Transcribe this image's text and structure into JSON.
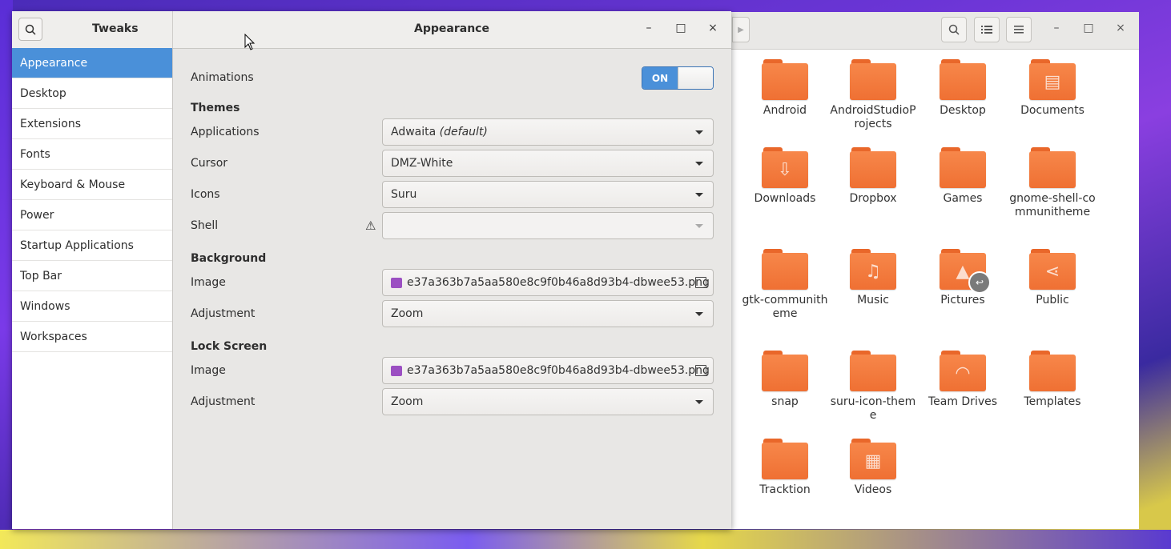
{
  "tweaks": {
    "app_name": "Tweaks",
    "title": "Appearance",
    "sidebar": [
      {
        "label": "Appearance",
        "active": true
      },
      {
        "label": "Desktop"
      },
      {
        "label": "Extensions"
      },
      {
        "label": "Fonts"
      },
      {
        "label": "Keyboard & Mouse"
      },
      {
        "label": "Power"
      },
      {
        "label": "Startup Applications"
      },
      {
        "label": "Top Bar"
      },
      {
        "label": "Windows"
      },
      {
        "label": "Workspaces"
      }
    ],
    "animations": {
      "label": "Animations",
      "state": "ON"
    },
    "themes": {
      "heading": "Themes",
      "applications": {
        "label": "Applications",
        "value": "Adwaita",
        "value_suffix": "(default)"
      },
      "cursor": {
        "label": "Cursor",
        "value": "DMZ-White"
      },
      "icons": {
        "label": "Icons",
        "value": "Suru"
      },
      "shell": {
        "label": "Shell",
        "value": "",
        "warning_icon": "warning-icon"
      }
    },
    "background": {
      "heading": "Background",
      "image": {
        "label": "Image",
        "value": "e37a363b7a5aa580e8c9f0b46a8d93b4-dbwee53.png"
      },
      "adjustment": {
        "label": "Adjustment",
        "value": "Zoom"
      }
    },
    "lock_screen": {
      "heading": "Lock Screen",
      "image": {
        "label": "Image",
        "value": "e37a363b7a5aa580e8c9f0b46a8d93b4-dbwee53.png"
      },
      "adjustment": {
        "label": "Adjustment",
        "value": "Zoom"
      }
    },
    "controls": {
      "minimize": "–",
      "maximize": "□",
      "close": "×"
    }
  },
  "files": {
    "folders": [
      {
        "name": "Android",
        "icon": ""
      },
      {
        "name": "AndroidStudioProjects",
        "icon": ""
      },
      {
        "name": "Desktop",
        "icon": ""
      },
      {
        "name": "Documents",
        "icon": "document-icon"
      },
      {
        "name": "Downloads",
        "icon": "download-icon"
      },
      {
        "name": "Dropbox",
        "icon": ""
      },
      {
        "name": "Games",
        "icon": ""
      },
      {
        "name": "gnome-shell-communitheme",
        "icon": ""
      },
      {
        "name": "gtk-communitheme",
        "icon": ""
      },
      {
        "name": "Music",
        "icon": "music-icon"
      },
      {
        "name": "Pictures",
        "icon": "picture-icon"
      },
      {
        "name": "Public",
        "icon": "share-icon"
      },
      {
        "name": "snap",
        "icon": ""
      },
      {
        "name": "suru-icon-theme",
        "icon": ""
      },
      {
        "name": "Team Drives",
        "icon": "wifi-icon"
      },
      {
        "name": "Templates",
        "icon": ""
      },
      {
        "name": "Tracktion",
        "icon": ""
      },
      {
        "name": "Videos",
        "icon": "film-icon"
      }
    ],
    "controls": {
      "minimize": "–",
      "maximize": "□",
      "close": "×"
    }
  },
  "colors": {
    "accent": "#4a90d9",
    "folder": "#f07a3d"
  }
}
